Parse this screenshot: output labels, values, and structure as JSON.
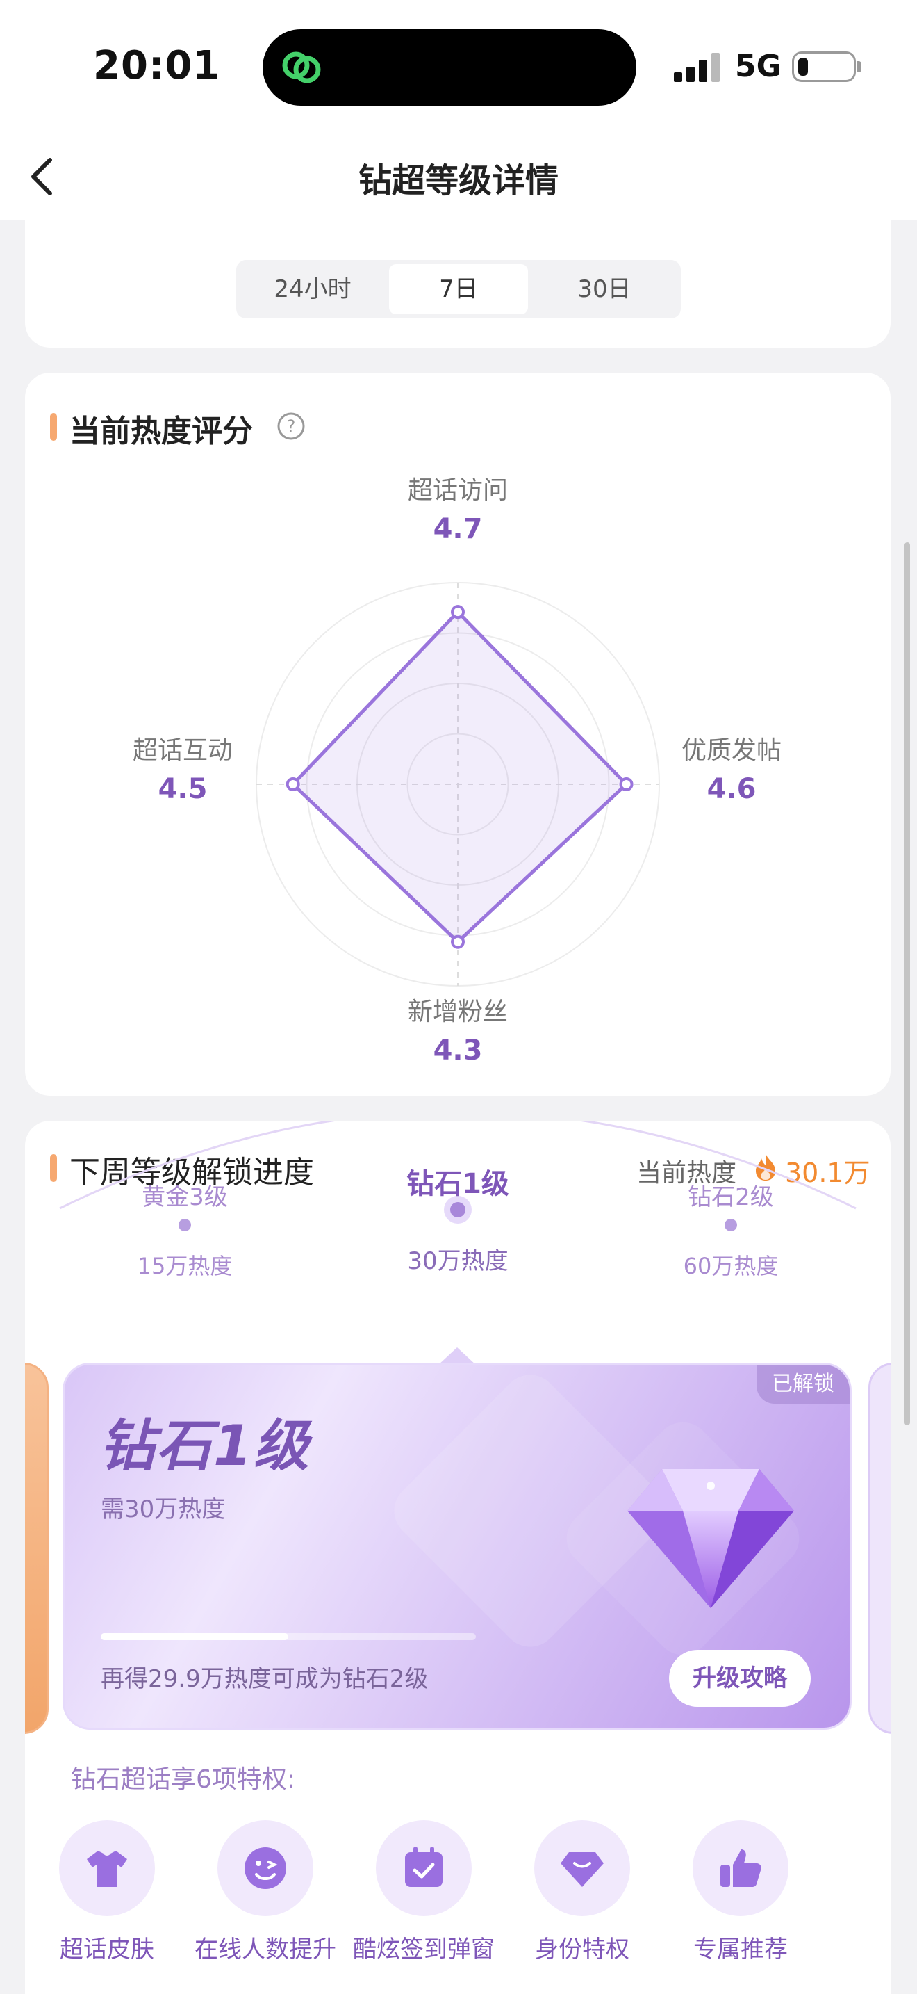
{
  "status_bar": {
    "time": "20:01",
    "network": "5G",
    "battery_level": 0.18,
    "signal_bars": 3
  },
  "nav": {
    "title": "钻超等级详情"
  },
  "range_selector": {
    "options": [
      "24小时",
      "7日",
      "30日"
    ],
    "selected": "7日"
  },
  "heat_score": {
    "title": "当前热度评分",
    "metrics": [
      {
        "name": "超话访问",
        "value": "4.7",
        "score": 4.7
      },
      {
        "name": "优质发帖",
        "value": "4.6",
        "score": 4.6
      },
      {
        "name": "新增粉丝",
        "value": "4.3",
        "score": 4.3
      },
      {
        "name": "超话互动",
        "value": "4.5",
        "score": 4.5
      }
    ]
  },
  "unlock_progress": {
    "title": "下周等级解锁进度",
    "current_heat_label": "当前热度",
    "current_heat_value": "30.1万",
    "levels": [
      {
        "name": "黄金3级",
        "requirement": "15万热度"
      },
      {
        "name": "钻石1级",
        "requirement": "30万热度"
      },
      {
        "name": "钻石2级",
        "requirement": "60万热度"
      }
    ],
    "card": {
      "badge": "已解锁",
      "level_name": "钻石1级",
      "need_text": "需30万热度",
      "progress": 0.5,
      "remaining_text": "再得29.9万热度可成为钻石2级",
      "upgrade_button": "升级攻略"
    },
    "privileges_title": "钻石超话享6项特权:",
    "privileges": [
      {
        "label": "超话皮肤",
        "icon": "shirt-icon"
      },
      {
        "label": "在线人数提升",
        "icon": "smile-icon"
      },
      {
        "label": "酷炫签到弹窗",
        "icon": "calendar-check-icon"
      },
      {
        "label": "身份特权",
        "icon": "gem-icon"
      },
      {
        "label": "专属推荐",
        "icon": "thumbs-up-icon"
      }
    ]
  },
  "colors": {
    "accent_purple": "#7e56b8",
    "accent_orange": "#f28a30",
    "section_bar": "#f6a870"
  }
}
